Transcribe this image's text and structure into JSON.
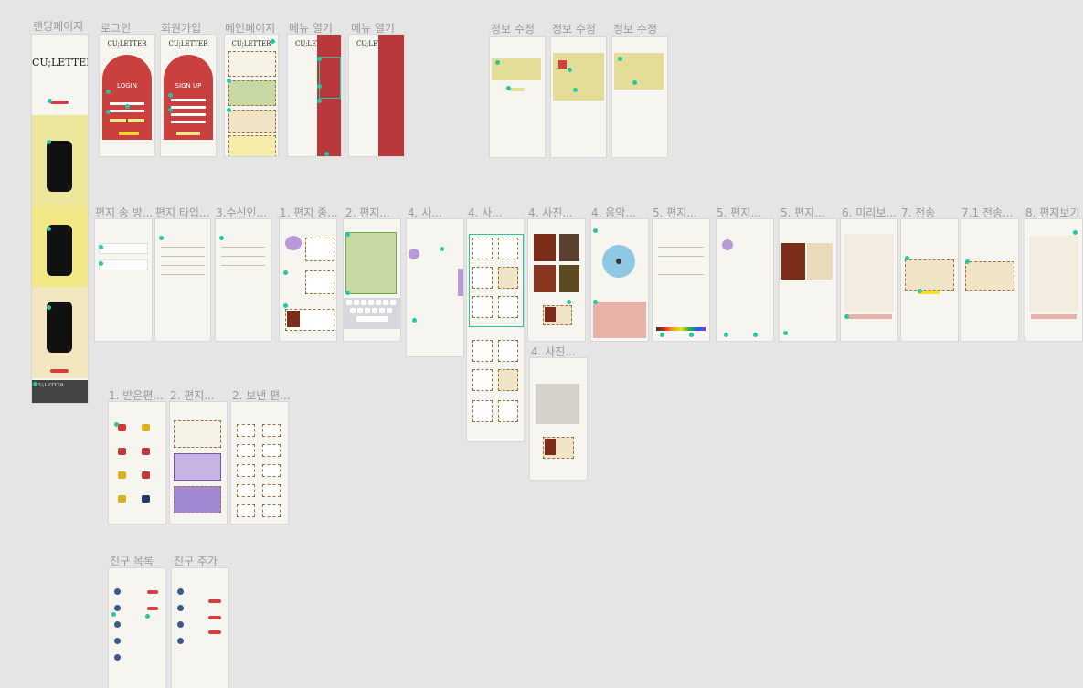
{
  "labels": {
    "landing": "랜딩페이지",
    "login": "로그인",
    "signup": "회원가입",
    "main": "메인페이지",
    "menu_open_1": "메뉴 열기",
    "menu_open_2": "메뉴 열기",
    "edit_info_1": "정보 수정",
    "edit_info_2": "정보 수정",
    "edit_info_3": "정보 수정",
    "letter_method": "편지 송 방...",
    "letter_type": "편지 타입...",
    "select_type": "3.수신인...",
    "step_1": "1. 편지 종...",
    "step_2": "2. 편지...",
    "step_4a": "4. 사...",
    "step_4b": "4. 사...",
    "step_4c": "4. 사진...",
    "step_4d": "4. 음악...",
    "step_5a": "5. 편지...",
    "step_5b": "5. 편지...",
    "step_5c": "5. 편지...",
    "step_6": "6. 미리보...",
    "step_7": "7. 전송",
    "step_7_1": "7.1 전송...",
    "step_8": "8. 편지보기",
    "step_4_photo": "4. 사진...",
    "receive_1": "1. 받은편...",
    "receive_2": "2. 편지...",
    "receive_3": "2. 보낸 편...",
    "friends_1": "친구 목록",
    "friends_2": "친구 추가"
  },
  "texts": {
    "brand": "CU;LETTER",
    "login": "LOGIN",
    "signup": "SIGN UP"
  },
  "colors": {
    "canvas": "#e5e5e5",
    "accent_red": "#c9403f",
    "marker": "#24c8a0"
  }
}
